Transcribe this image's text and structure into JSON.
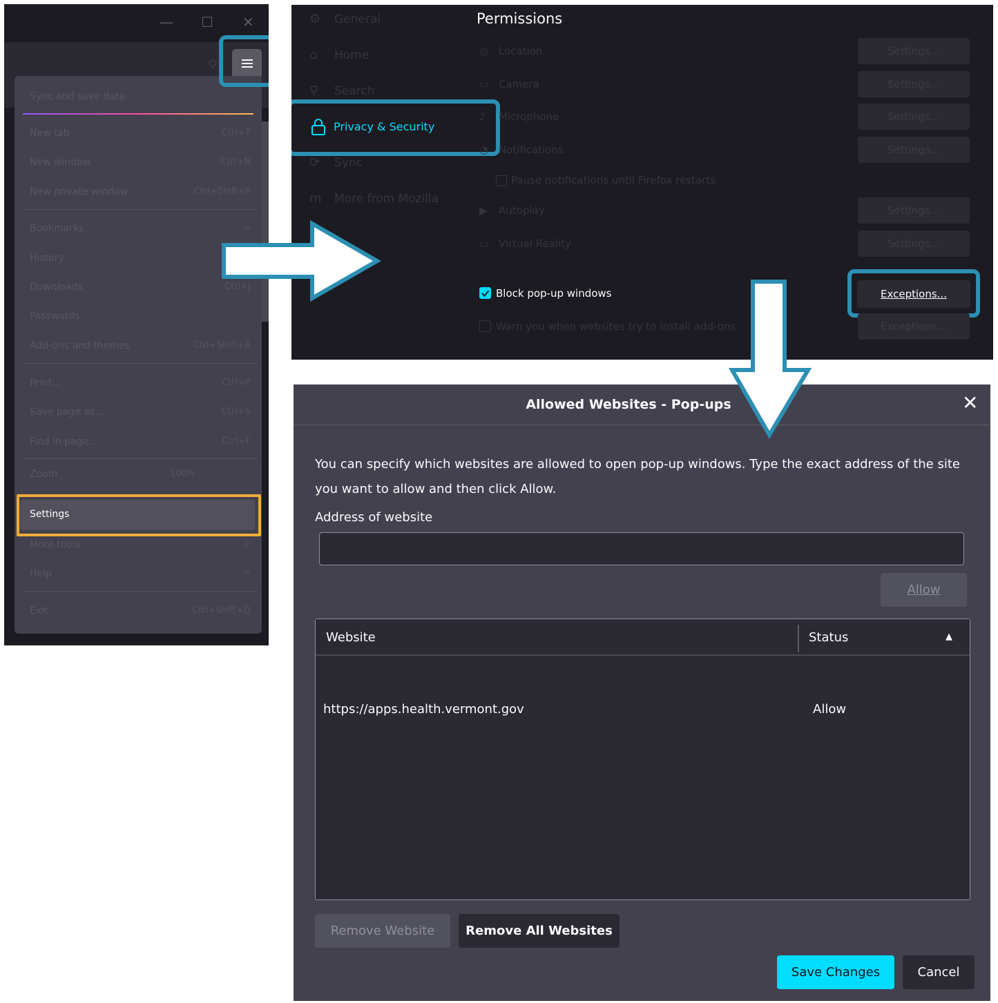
{
  "menu_panel": {
    "window_controls": {
      "minimize": "—",
      "maximize": "☐",
      "close": "✕"
    },
    "items": [
      {
        "label": "Sync and save data",
        "shortcut": ""
      },
      {
        "label": "New tab",
        "shortcut": "Ctrl+T"
      },
      {
        "label": "New window",
        "shortcut": "Ctrl+N"
      },
      {
        "label": "New private window",
        "shortcut": "Ctrl+Shift+P"
      },
      {
        "label": "Bookmarks",
        "shortcut": ">"
      },
      {
        "label": "History",
        "shortcut": ""
      },
      {
        "label": "Downloads",
        "shortcut": "Ctrl+J"
      },
      {
        "label": "Passwords",
        "shortcut": ""
      },
      {
        "label": "Add-ons and themes",
        "shortcut": "Ctrl+Shift+A"
      },
      {
        "label": "Print...",
        "shortcut": "Ctrl+P"
      },
      {
        "label": "Save page as...",
        "shortcut": "Ctrl+S"
      },
      {
        "label": "Find in page...",
        "shortcut": "Ctrl+F"
      },
      {
        "label": "Zoom",
        "shortcut": "100%"
      },
      {
        "label": "Settings",
        "shortcut": ""
      },
      {
        "label": "More tools",
        "shortcut": ">"
      },
      {
        "label": "Help",
        "shortcut": ">"
      },
      {
        "label": "Exit",
        "shortcut": "Ctrl+Shift+Q"
      }
    ],
    "highlight_color": "#f0ac3c"
  },
  "settings_panel": {
    "nav": [
      {
        "label": "General",
        "icon": "gear-icon"
      },
      {
        "label": "Home",
        "icon": "home-icon"
      },
      {
        "label": "Search",
        "icon": "search-icon"
      },
      {
        "label": "Privacy & Security",
        "icon": "lock-icon"
      },
      {
        "label": "Sync",
        "icon": "sync-icon"
      },
      {
        "label": "More from Mozilla",
        "icon": "mozilla-icon"
      }
    ],
    "section_title": "Permissions",
    "permissions": [
      {
        "label": "Location",
        "button": "Settings..."
      },
      {
        "label": "Camera",
        "button": "Settings..."
      },
      {
        "label": "Microphone",
        "button": "Settings..."
      },
      {
        "label": "Notifications",
        "button": "Settings..."
      },
      {
        "label": "Autoplay",
        "button": "Settings..."
      },
      {
        "label": "Virtual Reality",
        "button": "Settings..."
      }
    ],
    "pause_notifications": "Pause notifications until Firefox restarts",
    "block_popups_label": "Block pop-up windows",
    "exceptions_label": "Exceptions...",
    "warn_addons_label": "Warn you when websites try to install add-ons",
    "exceptions2_label": "Exceptions...",
    "accent_color": "#00ddff",
    "highlight_color": "#2c8fb3"
  },
  "dialog": {
    "title": "Allowed Websites - Pop-ups",
    "description": "You can specify which websites are allowed to open pop-up windows. Type the exact address of the site you want to allow and then click Allow.",
    "address_label": "Address of website",
    "address_value": "",
    "allow_button": "Allow",
    "columns": {
      "website": "Website",
      "status": "Status"
    },
    "rows": [
      {
        "website": "https://apps.health.vermont.gov",
        "status": "Allow"
      }
    ],
    "remove_website": "Remove Website",
    "remove_all": "Remove All Websites",
    "save_changes": "Save Changes",
    "cancel": "Cancel",
    "primary_color": "#00ddff"
  }
}
